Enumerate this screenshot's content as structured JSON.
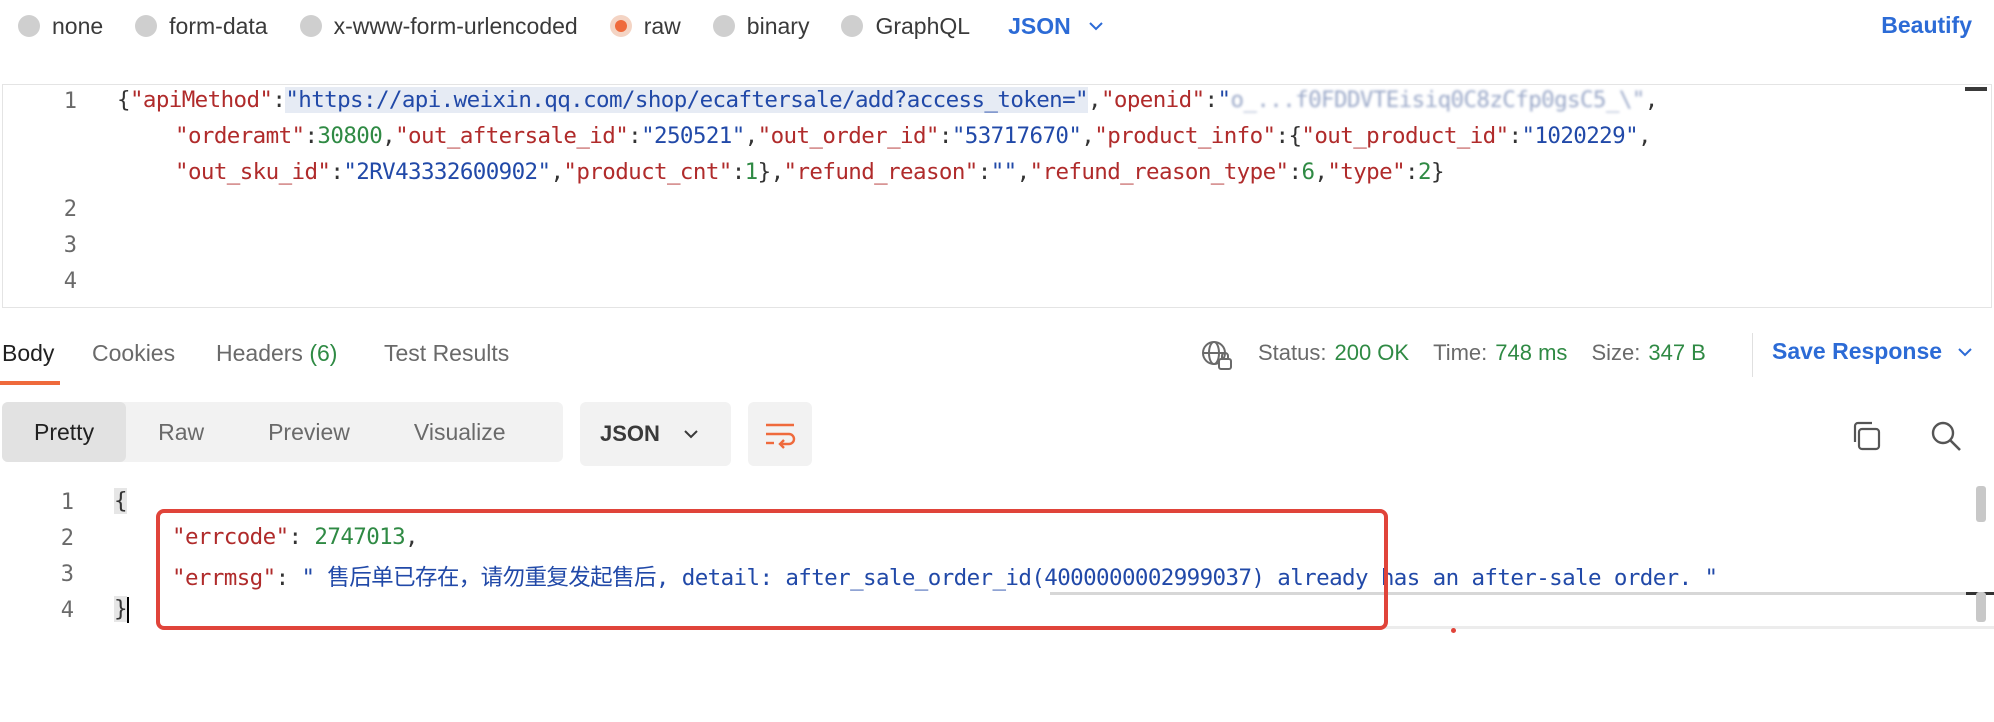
{
  "body_types": [
    {
      "label": "none",
      "selected": false
    },
    {
      "label": "form-data",
      "selected": false
    },
    {
      "label": "x-www-form-urlencoded",
      "selected": false
    },
    {
      "label": "raw",
      "selected": true
    },
    {
      "label": "binary",
      "selected": false
    },
    {
      "label": "GraphQL",
      "selected": false
    }
  ],
  "raw_language": "JSON",
  "beautify_label": "Beautify",
  "request_editor": {
    "line_numbers": [
      "1",
      "2",
      "3",
      "4"
    ],
    "line1": {
      "open": "{",
      "k_apiMethod": "\"apiMethod\"",
      "colon1": ":",
      "v_url": "\"https://api.weixin.qq.com/shop/ecaftersale/add?access_token=\"",
      "comma1": ",",
      "k_openid": "\"openid\"",
      "colon2": ":",
      "v_openid_visible": "\"",
      "v_openid_obscured": "o_...f0FDDVTEisiq0C8zCfp0gsC5_\\\"",
      "comma2": ","
    },
    "line1b": {
      "k_orderamt": "\"orderamt\"",
      "colon": ":",
      "v_orderamt": "30800",
      "c1": ",",
      "k_aftersale": "\"out_aftersale_id\"",
      "colon2": ":",
      "v_aftersale": "\"250521\"",
      "c2": ",",
      "k_order": "\"out_order_id\"",
      "colon3": ":",
      "v_order": "\"53717670\"",
      "c3": ",",
      "k_product_info": "\"product_info\"",
      "colon4": ":{",
      "k_product_id": "\"out_product_id\"",
      "colon5": ":",
      "v_product_id": "\"1020229\"",
      "c4": ","
    },
    "line1c": {
      "k_sku": "\"out_sku_id\"",
      "colon": ":",
      "v_sku": "\"2RV43332600902\"",
      "c1": ",",
      "k_cnt": "\"product_cnt\"",
      "colon2": ":",
      "v_cnt": "1",
      "close1": "},",
      "k_reason": "\"refund_reason\"",
      "colon3": ":",
      "v_reason": "\"\"",
      "c2": ",",
      "k_reason_type": "\"refund_reason_type\"",
      "colon4": ":",
      "v_reason_type": "6",
      "c3": ",",
      "k_type": "\"type\"",
      "colon5": ":",
      "v_type": "2",
      "close2": "}"
    }
  },
  "response_tabs": {
    "body": "Body",
    "cookies": "Cookies",
    "headers": "Headers",
    "headers_count": "(6)",
    "test_results": "Test Results"
  },
  "status": {
    "status_label": "Status:",
    "status_value": "200 OK",
    "time_label": "Time:",
    "time_value": "748 ms",
    "size_label": "Size:",
    "size_value": "347 B"
  },
  "save_response_label": "Save Response",
  "view_modes": [
    "Pretty",
    "Raw",
    "Preview",
    "Visualize"
  ],
  "response_format": "JSON",
  "response_body": {
    "line_numbers": [
      "1",
      "2",
      "3",
      "4"
    ],
    "open": "{",
    "k_errcode": "\"errcode\"",
    "sep1": ": ",
    "v_errcode": "2747013",
    "c1": ",",
    "k_errmsg": "\"errmsg\"",
    "sep2": ": ",
    "v_errmsg": "\" 售后单已存在，请勿重复发起售后, detail: after_sale_order_id(4000000002999037) already has an after-sale order. \"",
    "close": "}"
  },
  "colors": {
    "accent_orange": "#ef6a3c",
    "link_blue": "#2c6bd6",
    "status_green": "#2f8a44",
    "highlight_box_red": "#e0443a"
  },
  "icons": [
    "chevron-down-icon",
    "globe-lock-icon",
    "wrap-lines-icon",
    "copy-icon",
    "search-icon"
  ]
}
